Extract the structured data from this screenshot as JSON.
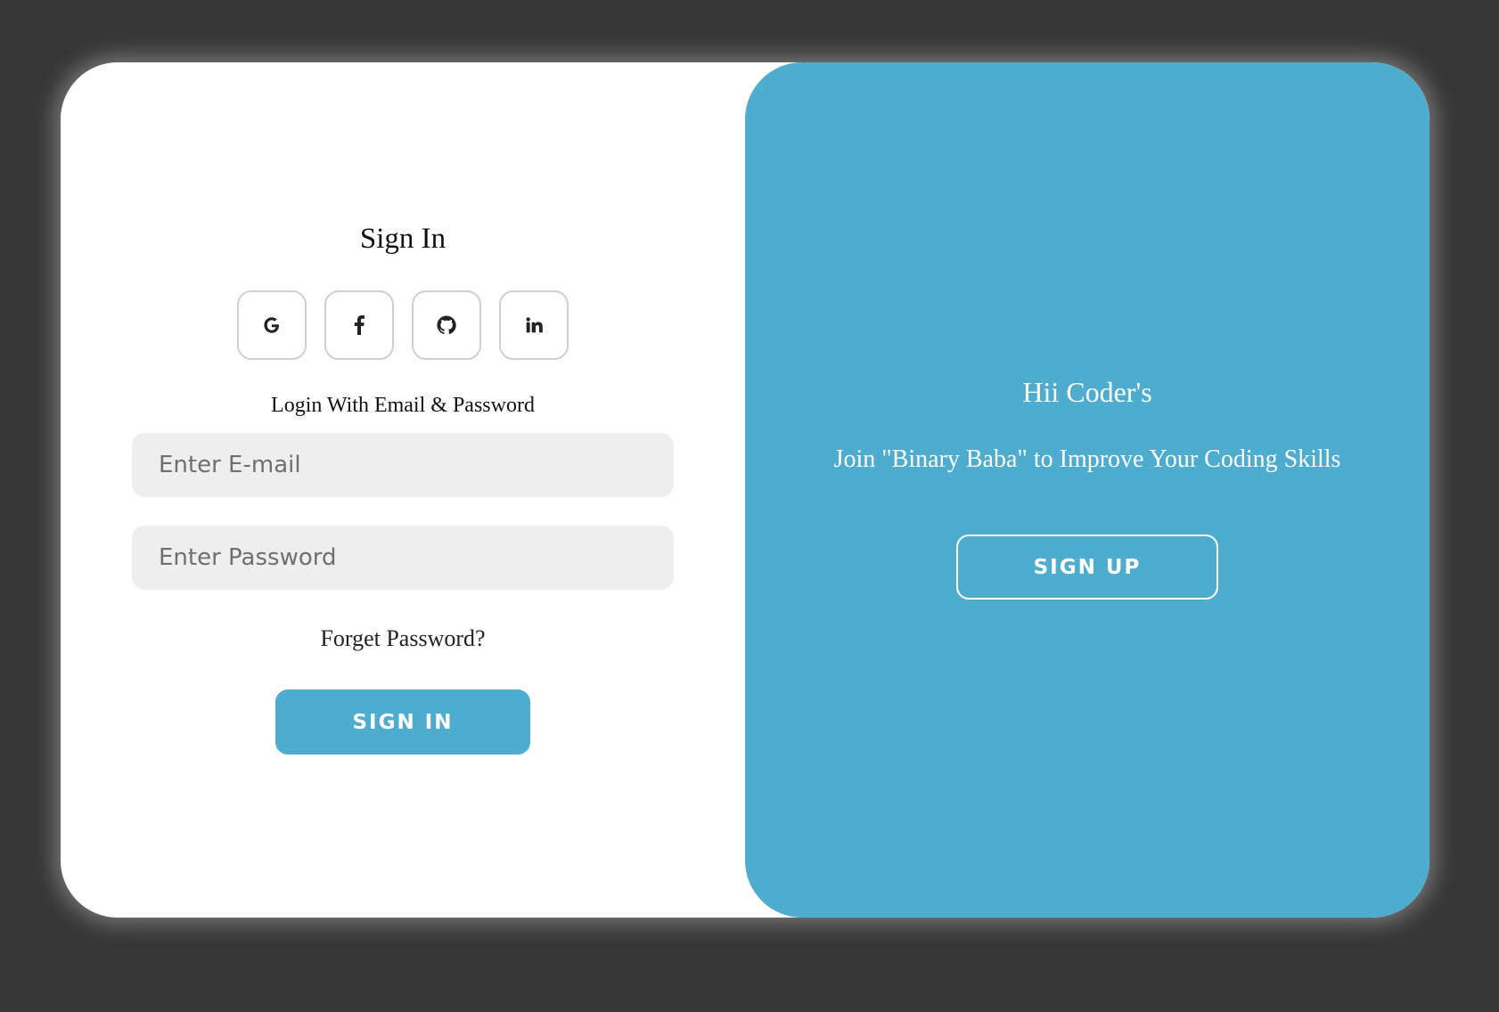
{
  "signin": {
    "title": "Sign In",
    "social": [
      {
        "name": "google",
        "icon": "google-icon"
      },
      {
        "name": "facebook",
        "icon": "facebook-icon"
      },
      {
        "name": "github",
        "icon": "github-icon"
      },
      {
        "name": "linkedin",
        "icon": "linkedin-icon"
      }
    ],
    "subtitle": "Login With Email & Password",
    "email_placeholder": "Enter E-mail",
    "password_placeholder": "Enter Password",
    "forgot_label": "Forget Password?",
    "button_label": "SIGN IN"
  },
  "signup": {
    "greeting": "Hii Coder's",
    "message": "Join \"Binary Baba\" to Improve Your Coding Skills",
    "button_label": "SIGN UP"
  },
  "colors": {
    "background": "#363636",
    "accent": "#4eacce",
    "input_bg": "#eeeeee",
    "card": "#ffffff"
  }
}
